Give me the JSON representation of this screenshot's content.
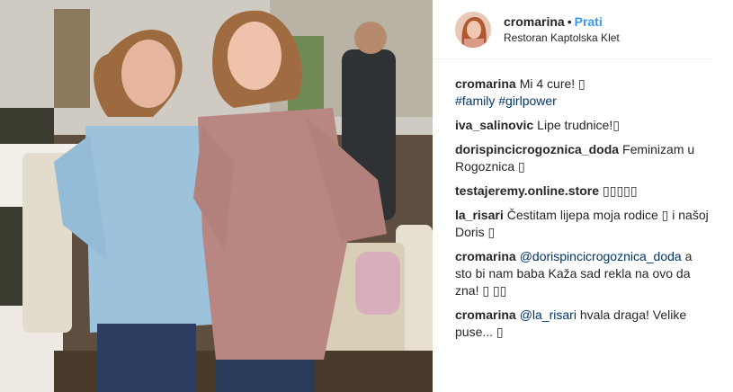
{
  "post": {
    "username": "cromarina",
    "separator": "•",
    "follow_label": "Prati",
    "location": "Restoran Kaptolska Klet"
  },
  "comments": [
    {
      "user": "cromarina",
      "parts": [
        "Mi 4 cure! ▯"
      ],
      "links": [
        "#family",
        "#girlpower"
      ]
    },
    {
      "user": "iva_salinovic",
      "text": "Lipe trudnice!▯"
    },
    {
      "user": "dorispincicrogoznica_doda",
      "text": "Feminizam u Rogoznica ▯"
    },
    {
      "user": "testajeremy.online.store",
      "text": "▯▯▯▯▯"
    },
    {
      "user": "la_risari",
      "text": "Čestitam lijepa moja rodice ▯ i našoj Doris ▯"
    },
    {
      "user": "cromarina",
      "mention": "@dorispincicrogoznica_doda",
      "text": " a sto bi nam baba Kaža sad rekla na ovo da zna! ▯ ▯▯"
    },
    {
      "user": "cromarina",
      "mention": "@la_risari",
      "text": " hvala draga! Velike puse... ▯"
    }
  ],
  "colors": {
    "follow": "#3897f0",
    "link": "#003569",
    "text": "#262626"
  },
  "icons": {
    "avatar": "profile-photo",
    "photo": "post-image"
  }
}
